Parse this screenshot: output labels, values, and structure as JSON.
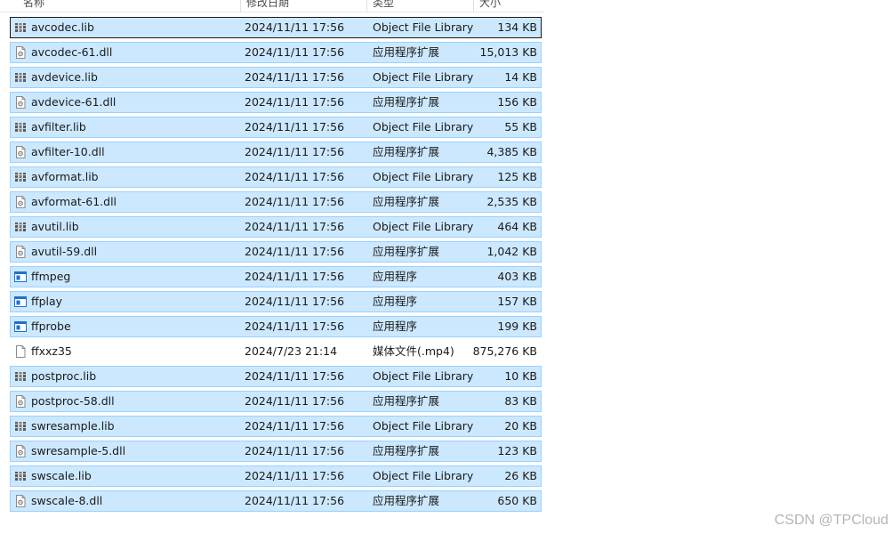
{
  "header": {
    "name": "名称",
    "date": "修改日期",
    "type": "类型",
    "size": "大小"
  },
  "files": [
    {
      "name": "avcodec.lib",
      "date": "2024/11/11 17:56",
      "type": "Object File Library",
      "size": "134 KB",
      "icon": "library-icon",
      "selected": true,
      "focused": true
    },
    {
      "name": "avcodec-61.dll",
      "date": "2024/11/11 17:56",
      "type": "应用程序扩展",
      "size": "15,013 KB",
      "icon": "dll-icon",
      "selected": true
    },
    {
      "name": "avdevice.lib",
      "date": "2024/11/11 17:56",
      "type": "Object File Library",
      "size": "14 KB",
      "icon": "library-icon",
      "selected": true
    },
    {
      "name": "avdevice-61.dll",
      "date": "2024/11/11 17:56",
      "type": "应用程序扩展",
      "size": "156 KB",
      "icon": "dll-icon",
      "selected": true
    },
    {
      "name": "avfilter.lib",
      "date": "2024/11/11 17:56",
      "type": "Object File Library",
      "size": "55 KB",
      "icon": "library-icon",
      "selected": true
    },
    {
      "name": "avfilter-10.dll",
      "date": "2024/11/11 17:56",
      "type": "应用程序扩展",
      "size": "4,385 KB",
      "icon": "dll-icon",
      "selected": true
    },
    {
      "name": "avformat.lib",
      "date": "2024/11/11 17:56",
      "type": "Object File Library",
      "size": "125 KB",
      "icon": "library-icon",
      "selected": true
    },
    {
      "name": "avformat-61.dll",
      "date": "2024/11/11 17:56",
      "type": "应用程序扩展",
      "size": "2,535 KB",
      "icon": "dll-icon",
      "selected": true
    },
    {
      "name": "avutil.lib",
      "date": "2024/11/11 17:56",
      "type": "Object File Library",
      "size": "464 KB",
      "icon": "library-icon",
      "selected": true
    },
    {
      "name": "avutil-59.dll",
      "date": "2024/11/11 17:56",
      "type": "应用程序扩展",
      "size": "1,042 KB",
      "icon": "dll-icon",
      "selected": true
    },
    {
      "name": "ffmpeg",
      "date": "2024/11/11 17:56",
      "type": "应用程序",
      "size": "403 KB",
      "icon": "application-icon",
      "selected": true
    },
    {
      "name": "ffplay",
      "date": "2024/11/11 17:56",
      "type": "应用程序",
      "size": "157 KB",
      "icon": "application-icon",
      "selected": true
    },
    {
      "name": "ffprobe",
      "date": "2024/11/11 17:56",
      "type": "应用程序",
      "size": "199 KB",
      "icon": "application-icon",
      "selected": true
    },
    {
      "name": "ffxxz35",
      "date": "2024/7/23 21:14",
      "type": "媒体文件(.mp4)",
      "size": "875,276 KB",
      "icon": "file-icon",
      "selected": false
    },
    {
      "name": "postproc.lib",
      "date": "2024/11/11 17:56",
      "type": "Object File Library",
      "size": "10 KB",
      "icon": "library-icon",
      "selected": true
    },
    {
      "name": "postproc-58.dll",
      "date": "2024/11/11 17:56",
      "type": "应用程序扩展",
      "size": "83 KB",
      "icon": "dll-icon",
      "selected": true
    },
    {
      "name": "swresample.lib",
      "date": "2024/11/11 17:56",
      "type": "Object File Library",
      "size": "20 KB",
      "icon": "library-icon",
      "selected": true
    },
    {
      "name": "swresample-5.dll",
      "date": "2024/11/11 17:56",
      "type": "应用程序扩展",
      "size": "123 KB",
      "icon": "dll-icon",
      "selected": true
    },
    {
      "name": "swscale.lib",
      "date": "2024/11/11 17:56",
      "type": "Object File Library",
      "size": "26 KB",
      "icon": "library-icon",
      "selected": true
    },
    {
      "name": "swscale-8.dll",
      "date": "2024/11/11 17:56",
      "type": "应用程序扩展",
      "size": "650 KB",
      "icon": "dll-icon",
      "selected": true
    }
  ],
  "watermark": "CSDN @TPCloud",
  "colors": {
    "selection_fill": "#cce8ff",
    "selection_border": "#99d1ff",
    "focus_border": "#1a1a1a",
    "app_icon_blue": "#1f6fd1"
  }
}
